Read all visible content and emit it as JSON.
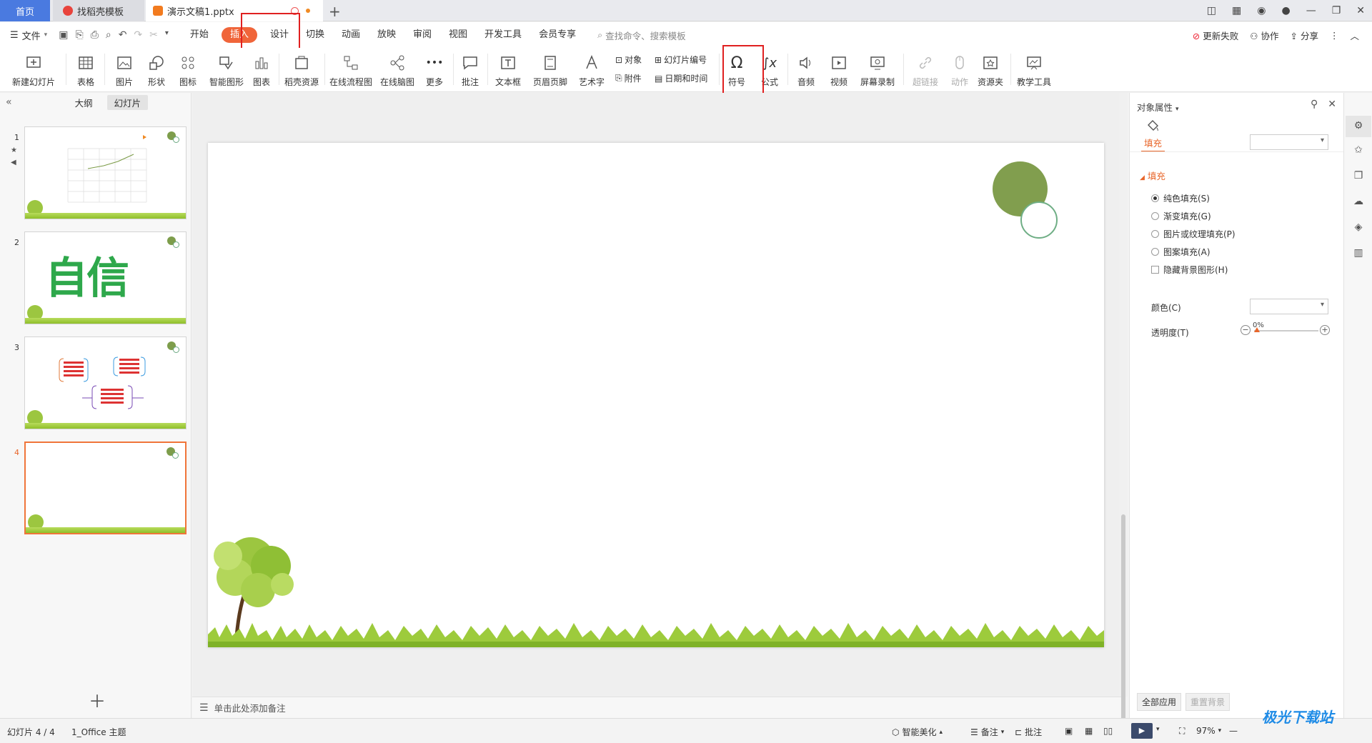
{
  "titlebar": {
    "home_tab": "首页",
    "template_tab": "找稻壳模板",
    "doc_tab": "演示文稿1.pptx",
    "add_tab": "+"
  },
  "menubar": {
    "file": "文件",
    "tabs": [
      "开始",
      "插入",
      "设计",
      "切换",
      "动画",
      "放映",
      "审阅",
      "视图",
      "开发工具",
      "会员专享"
    ],
    "active_tab": "插入",
    "search_placeholder": "查找命令、搜索模板",
    "update_failed": "更新失败",
    "collaborate": "协作",
    "share": "分享"
  },
  "ribbon": {
    "new_slide": "新建幻灯片",
    "table": "表格",
    "picture": "图片",
    "shape": "形状",
    "icon": "图标",
    "smart_graphic": "智能图形",
    "chart": "图表",
    "docer_resources": "稻壳资源",
    "online_flowchart": "在线流程图",
    "online_mindmap": "在线脑图",
    "more": "更多",
    "comment": "批注",
    "textbox": "文本框",
    "header_footer": "页眉页脚",
    "wordart": "艺术字",
    "object": "对象",
    "slide_number": "幻灯片编号",
    "attachment": "附件",
    "date_time": "日期和时间",
    "symbol": "符号",
    "formula": "公式",
    "audio": "音频",
    "video": "视频",
    "screen_record": "屏幕录制",
    "hyperlink": "超链接",
    "action": "动作",
    "resource_folder": "资源夹",
    "teaching_tools": "教学工具"
  },
  "leftpane": {
    "outline_tab": "大纲",
    "slides_tab": "幻灯片",
    "slides": [
      {
        "num": "1"
      },
      {
        "num": "2",
        "text": "自信"
      },
      {
        "num": "3"
      },
      {
        "num": "4"
      }
    ],
    "current": "4"
  },
  "notes": {
    "placeholder": "单击此处添加备注"
  },
  "properties": {
    "title": "对象属性",
    "fill_tab": "填充",
    "fill_section": "填充",
    "options": [
      "纯色填充(S)",
      "渐变填充(G)",
      "图片或纹理填充(P)",
      "图案填充(A)"
    ],
    "selected_option": "纯色填充(S)",
    "hide_bg": "隐藏背景图形(H)",
    "color_label": "颜色(C)",
    "transparency_label": "透明度(T)",
    "transparency_value": "0%",
    "apply_all": "全部应用",
    "reset_bg": "重置背景"
  },
  "statusbar": {
    "slide_info": "幻灯片 4 / 4",
    "theme": "1_Office 主题",
    "smart_beautify": "智能美化",
    "notes": "备注",
    "comment": "批注",
    "zoom": "97%"
  },
  "watermark": "极光下载站",
  "colors": {
    "accent": "#f0653a",
    "highlight_box": "#e02020",
    "circle_fill": "#819e4e",
    "ring": "#6fae85"
  }
}
